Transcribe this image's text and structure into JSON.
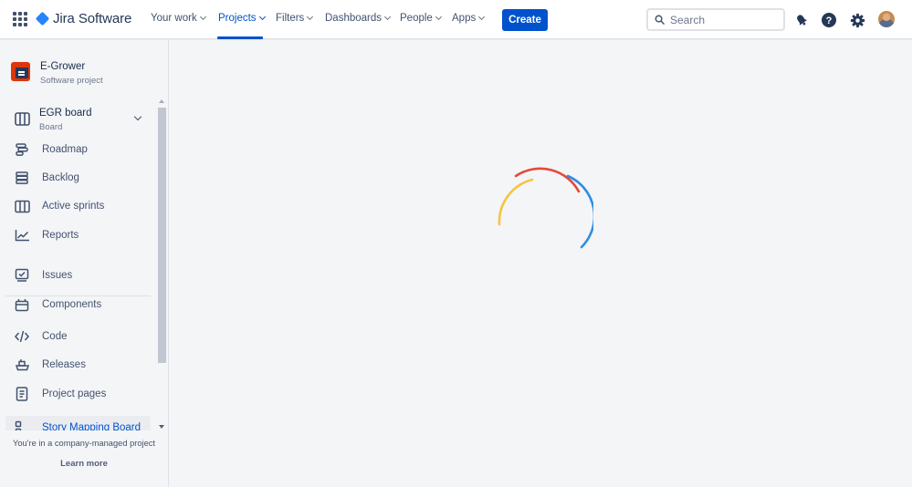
{
  "topnav": {
    "product": "Jira Software",
    "items": [
      {
        "label": "Your work",
        "active": false
      },
      {
        "label": "Projects",
        "active": true
      },
      {
        "label": "Filters",
        "active": false
      },
      {
        "label": "Dashboards",
        "active": false
      },
      {
        "label": "People",
        "active": false
      },
      {
        "label": "Apps",
        "active": false
      }
    ],
    "create_label": "Create",
    "search_placeholder": "Search",
    "icons": [
      "app-switcher-icon",
      "notifications-icon",
      "help-icon",
      "settings-icon",
      "avatar"
    ]
  },
  "sidebar": {
    "project_name": "E-Grower",
    "project_type": "Software project",
    "board": {
      "title": "EGR board",
      "subtitle": "Board"
    },
    "items": [
      {
        "label": "Roadmap",
        "icon": "roadmap-icon"
      },
      {
        "label": "Backlog",
        "icon": "backlog-icon"
      },
      {
        "label": "Active sprints",
        "icon": "active-sprints-icon"
      },
      {
        "label": "Reports",
        "icon": "reports-icon"
      },
      {
        "label": "Issues",
        "icon": "issues-icon"
      },
      {
        "label": "Components",
        "icon": "components-icon"
      },
      {
        "label": "Code",
        "icon": "code-icon"
      },
      {
        "label": "Releases",
        "icon": "releases-icon"
      },
      {
        "label": "Project pages",
        "icon": "project-pages-icon"
      },
      {
        "label": "Story Mapping Board",
        "icon": "story-mapping-icon",
        "selected": true
      }
    ],
    "footer_note": "You're in a company-managed project",
    "learn_more": "Learn more"
  },
  "main": {
    "state": "loading",
    "spinner_colors": [
      "#f4c542",
      "#e5493a",
      "#2e8de3"
    ]
  }
}
